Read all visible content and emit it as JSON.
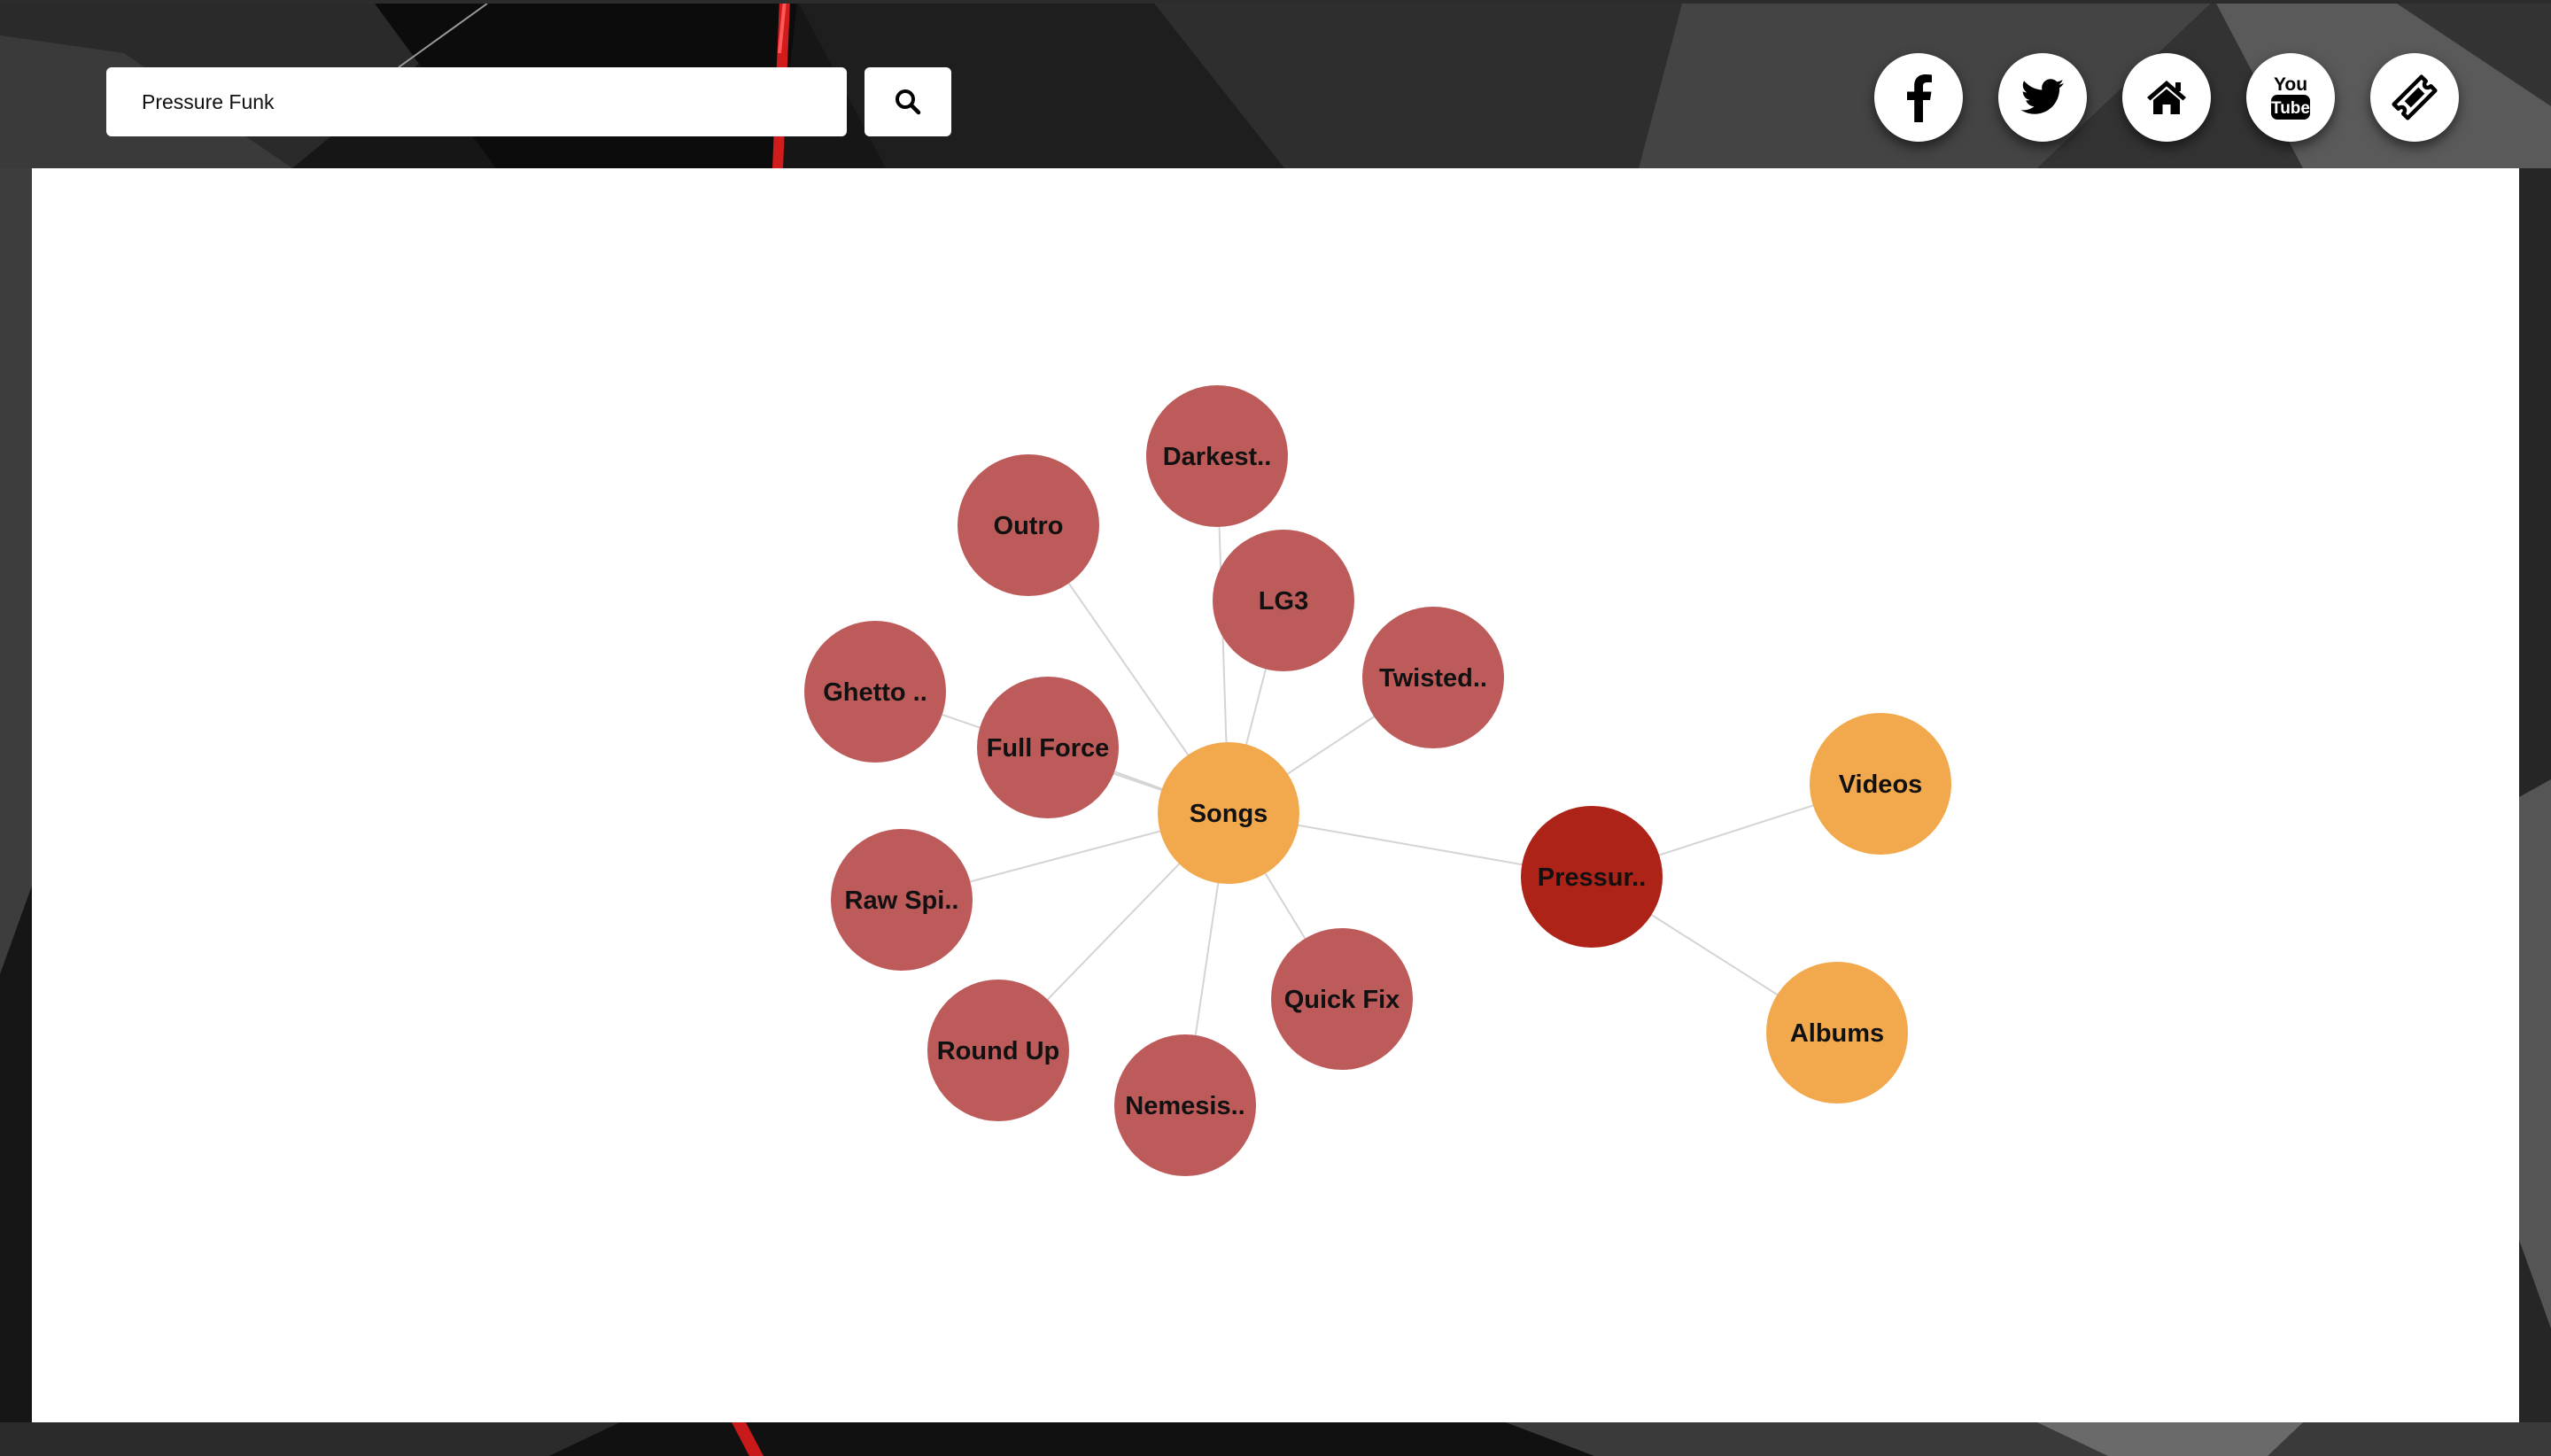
{
  "search": {
    "value": "Pressure Funk"
  },
  "social": [
    {
      "icon": "facebook-icon"
    },
    {
      "icon": "twitter-icon"
    },
    {
      "icon": "home-icon"
    },
    {
      "icon": "youtube-icon",
      "text_top": "You",
      "text_bottom": "Tube"
    },
    {
      "icon": "ticket-icon"
    }
  ],
  "colors": {
    "song": "#bd5b5a",
    "category": "#f2a94d",
    "artist": "#ae2318",
    "link": "#d4d4d4"
  },
  "graph": {
    "nodes": [
      {
        "id": "artist",
        "label": "Pressur..",
        "kind": "artist"
      },
      {
        "id": "songs",
        "label": "Songs",
        "kind": "category"
      },
      {
        "id": "videos",
        "label": "Videos",
        "kind": "category"
      },
      {
        "id": "albums",
        "label": "Albums",
        "kind": "category"
      },
      {
        "id": "darkest",
        "label": "Darkest..",
        "kind": "song"
      },
      {
        "id": "outro",
        "label": "Outro",
        "kind": "song"
      },
      {
        "id": "lg3",
        "label": "LG3",
        "kind": "song"
      },
      {
        "id": "twisted",
        "label": "Twisted..",
        "kind": "song"
      },
      {
        "id": "ghetto",
        "label": "Ghetto ..",
        "kind": "song"
      },
      {
        "id": "fullforce",
        "label": "Full Force",
        "kind": "song"
      },
      {
        "id": "rawspi",
        "label": "Raw Spi..",
        "kind": "song"
      },
      {
        "id": "roundup",
        "label": "Round Up",
        "kind": "song"
      },
      {
        "id": "nemesis",
        "label": "Nemesis..",
        "kind": "song"
      },
      {
        "id": "quickfix",
        "label": "Quick Fix",
        "kind": "song"
      }
    ],
    "links": [
      [
        "songs",
        "artist"
      ],
      [
        "artist",
        "videos"
      ],
      [
        "artist",
        "albums"
      ],
      [
        "songs",
        "darkest"
      ],
      [
        "songs",
        "outro"
      ],
      [
        "songs",
        "lg3"
      ],
      [
        "songs",
        "twisted"
      ],
      [
        "songs",
        "ghetto"
      ],
      [
        "songs",
        "fullforce"
      ],
      [
        "songs",
        "rawspi"
      ],
      [
        "songs",
        "roundup"
      ],
      [
        "songs",
        "nemesis"
      ],
      [
        "songs",
        "quickfix"
      ]
    ]
  }
}
